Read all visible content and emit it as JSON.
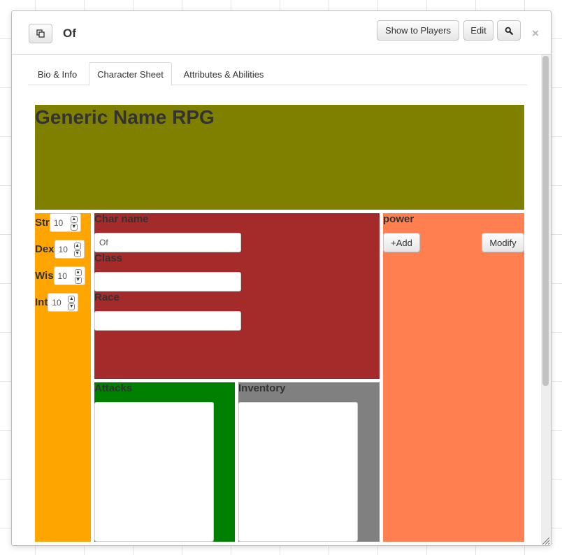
{
  "window": {
    "title": "Of",
    "buttons": {
      "show_players": "Show to Players",
      "edit": "Edit"
    },
    "close_glyph": "×",
    "popout_icon": "popout-icon",
    "search_icon": "search-icon"
  },
  "tabs": [
    {
      "label": "Bio & Info",
      "active": false
    },
    {
      "label": "Character Sheet",
      "active": true
    },
    {
      "label": "Attributes & Abilities",
      "active": false
    }
  ],
  "sheet": {
    "game_title": "Generic Name RPG",
    "stats": [
      {
        "label": "Str",
        "value": "10"
      },
      {
        "label": "Dex",
        "value": "10"
      },
      {
        "label": "Wis",
        "value": "10"
      },
      {
        "label": "Int",
        "value": "10"
      }
    ],
    "fields": {
      "char_name_label": "Char name",
      "char_name_value": "Of",
      "class_label": "Class",
      "class_value": "",
      "race_label": "Race",
      "race_value": ""
    },
    "attacks_label": "Attacks",
    "inventory_label": "Inventory",
    "power": {
      "label": "power",
      "add": "+Add",
      "modify": "Modify"
    }
  },
  "colors": {
    "header": "#808000",
    "stats": "#ffa500",
    "main": "#a52a2a",
    "attacks": "#008000",
    "inventory": "#808080",
    "power": "#ff7f50"
  }
}
